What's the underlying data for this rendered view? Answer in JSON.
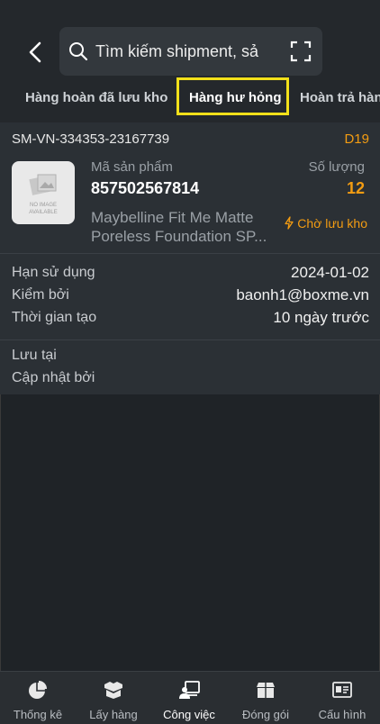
{
  "search": {
    "placeholder": "Tìm kiếm shipment, sả"
  },
  "tabs": [
    {
      "label": "Hàng hoàn đã lưu kho"
    },
    {
      "label": "Hàng hư hỏng"
    },
    {
      "label": "Hoàn trả hàn"
    }
  ],
  "active_tab": "Hàng hư hỏng",
  "item": {
    "shipment_id": "SM-VN-334353-23167739",
    "location": "D19",
    "no_image_text": [
      "NO IMAGE",
      "AVAILABLE"
    ],
    "product_code_label": "Mã sản phẩm",
    "product_code": "857502567814",
    "quantity_label": "Số lượng",
    "quantity": "12",
    "product_name_line1": "Maybelline Fit Me Matte",
    "product_name_line2": "Poreless Foundation SP...",
    "status": "Chờ lưu kho",
    "expiry_label": "Hạn sử dụng",
    "expiry_value": "2024-01-02",
    "checked_by_label": "Kiểm bởi",
    "checked_by_value": "baonh1@boxme.vn",
    "created_label": "Thời gian tạo",
    "created_value": "10 ngày trước",
    "stored_at_label": "Lưu tại",
    "updated_by_label": "Cập nhật bởi"
  },
  "bottom_nav": [
    {
      "label": "Thống kê",
      "icon": "pie-chart-icon"
    },
    {
      "label": "Lấy hàng",
      "icon": "boxes-icon"
    },
    {
      "label": "Công việc",
      "icon": "worker-icon",
      "active": true
    },
    {
      "label": "Đóng gói",
      "icon": "package-icon"
    },
    {
      "label": "Cấu hình",
      "icon": "id-card-icon"
    }
  ],
  "colors": {
    "accent": "#f39c12",
    "highlight": "#f2e01a",
    "background": "#1f2327",
    "card": "#2b3035"
  }
}
